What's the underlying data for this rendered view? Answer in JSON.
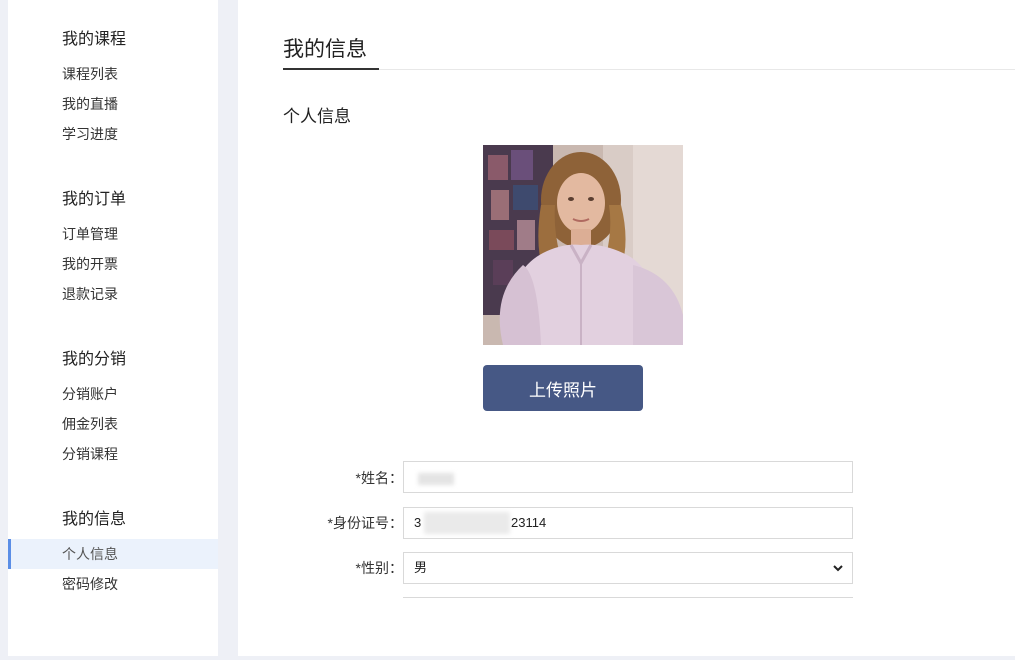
{
  "sidebar": {
    "groups": [
      {
        "title": "我的课程",
        "items": [
          {
            "label": "课程列表"
          },
          {
            "label": "我的直播"
          },
          {
            "label": "学习进度"
          }
        ]
      },
      {
        "title": "我的订单",
        "items": [
          {
            "label": "订单管理"
          },
          {
            "label": "我的开票"
          },
          {
            "label": "退款记录"
          }
        ]
      },
      {
        "title": "我的分销",
        "items": [
          {
            "label": "分销账户"
          },
          {
            "label": "佣金列表"
          },
          {
            "label": "分销课程"
          }
        ]
      },
      {
        "title": "我的信息",
        "items": [
          {
            "label": "个人信息",
            "active": true
          },
          {
            "label": "密码修改"
          }
        ]
      }
    ]
  },
  "main": {
    "page_title": "我的信息",
    "section_title": "个人信息",
    "upload_button": "上传照片",
    "form": {
      "name_label": "*姓名：",
      "id_label": "*身份证号：",
      "id_prefix": "3",
      "id_suffix": "23114",
      "gender_label": "*性别：",
      "gender_value": "男"
    }
  },
  "colors": {
    "accent": "#465885",
    "active_bg": "#ebf2fc",
    "active_border": "#5b8ee6",
    "page_bg": "#eef0f6"
  }
}
